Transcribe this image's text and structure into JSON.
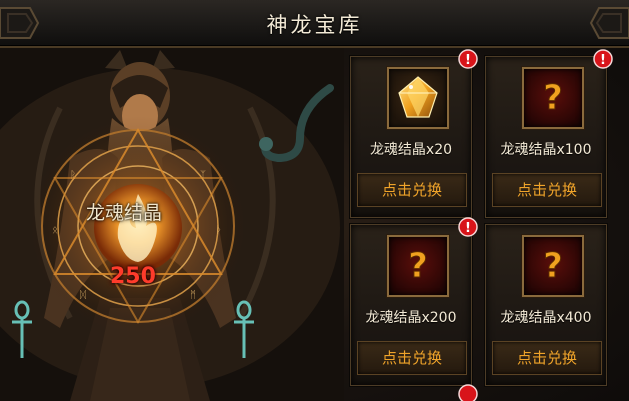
{
  "window": {
    "title": "神龙宝库"
  },
  "crystal": {
    "label": "龙魂结晶",
    "count": "250"
  },
  "rewards": [
    {
      "name": "龙魂结晶x20",
      "button": "点击兑换",
      "icon": "gold-gem-icon",
      "alert": true
    },
    {
      "name": "龙魂结晶x100",
      "button": "点击兑换",
      "icon": "question-mark-icon",
      "alert": true
    },
    {
      "name": "龙魂结晶x200",
      "button": "点击兑换",
      "icon": "question-mark-icon",
      "alert": true
    },
    {
      "name": "龙魂结晶x400",
      "button": "点击兑换",
      "icon": "question-mark-icon",
      "alert": false
    }
  ],
  "colors": {
    "accent": "#f0a42a",
    "count": "#ff3b2b",
    "alert": "#d8141a",
    "frame": "#8a6a3c"
  }
}
